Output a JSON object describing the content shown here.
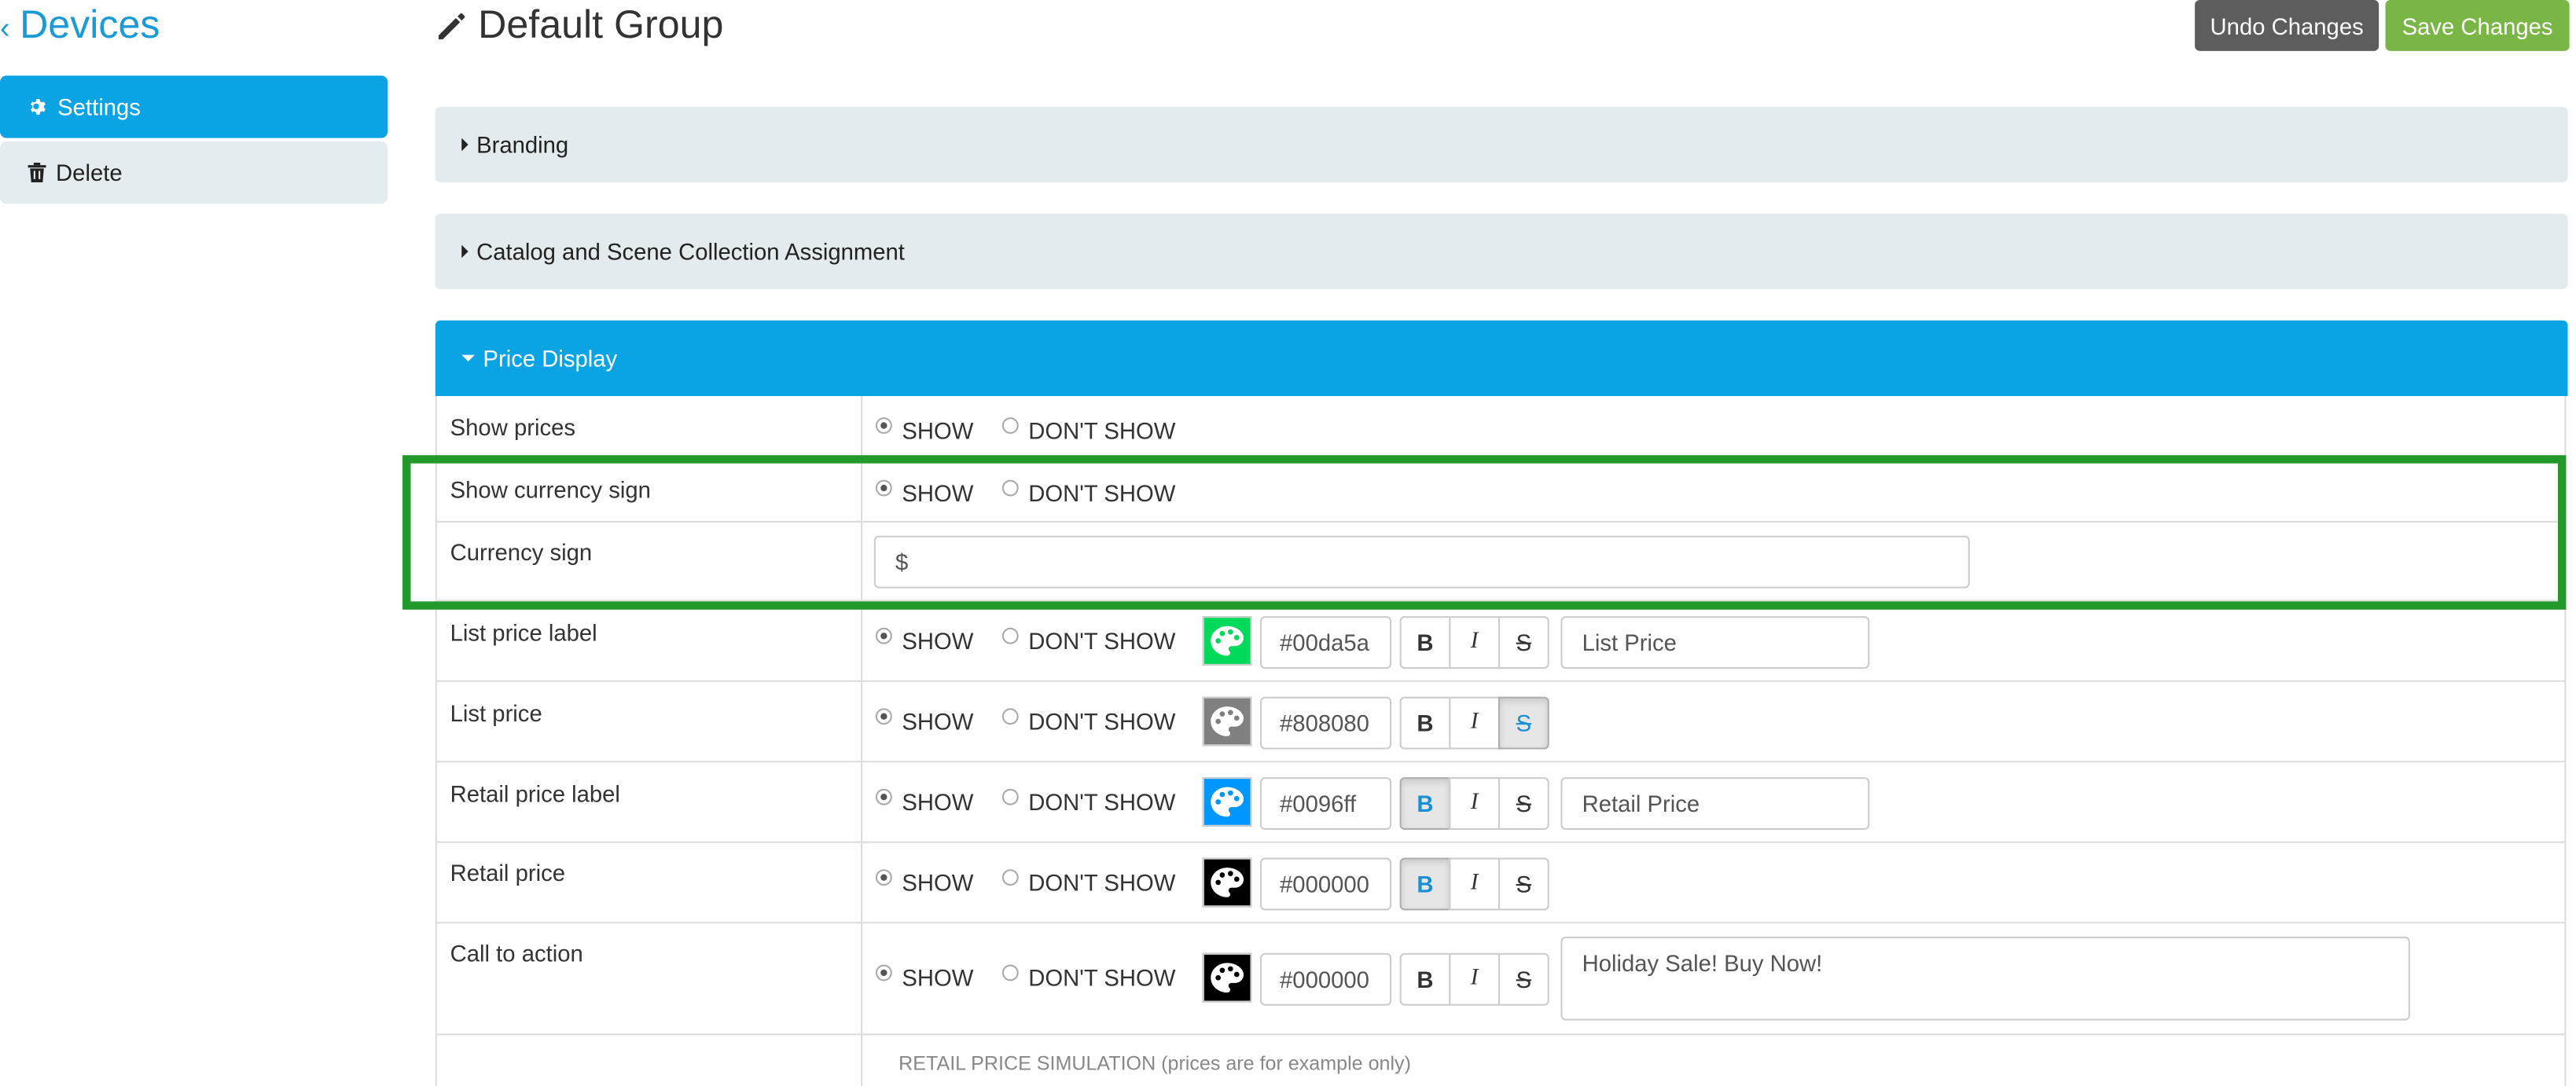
{
  "nav": {
    "back_label": "Devices",
    "items": [
      {
        "label": "Settings",
        "icon": "gear-icon",
        "active": true
      },
      {
        "label": "Delete",
        "icon": "trash-icon",
        "active": false
      }
    ]
  },
  "header": {
    "title": "Default Group",
    "title_icon": "pencil-icon",
    "undo_label": "Undo Changes",
    "save_label": "Save Changes"
  },
  "sections": {
    "branding": "Branding",
    "catalog": "Catalog and Scene Collection Assignment",
    "price_display": "Price Display"
  },
  "radio": {
    "show": "SHOW",
    "dont_show": "DON'T SHOW"
  },
  "rows": {
    "show_prices": {
      "label": "Show prices",
      "selected": "SHOW"
    },
    "show_currency_sign": {
      "label": "Show currency sign",
      "selected": "SHOW"
    },
    "currency_sign": {
      "label": "Currency sign",
      "value": "$"
    },
    "list_price_label": {
      "label": "List price label",
      "selected": "SHOW",
      "color": "#00da5a",
      "bold": false,
      "italic": false,
      "strike": false,
      "text": "List Price"
    },
    "list_price": {
      "label": "List price",
      "selected": "SHOW",
      "color": "#808080",
      "bold": false,
      "italic": false,
      "strike": true
    },
    "retail_price_label": {
      "label": "Retail price label",
      "selected": "SHOW",
      "color": "#0096ff",
      "bold": true,
      "italic": false,
      "strike": false,
      "text": "Retail Price"
    },
    "retail_price": {
      "label": "Retail price",
      "selected": "SHOW",
      "color": "#000000",
      "bold": true,
      "italic": false,
      "strike": false
    },
    "call_to_action": {
      "label": "Call to action",
      "selected": "SHOW",
      "color": "#000000",
      "bold": false,
      "italic": false,
      "strike": false,
      "text": "Holiday Sale! Buy Now!"
    }
  },
  "format": {
    "bold": "B",
    "italic": "I",
    "strike": "S"
  },
  "simulation_label": "RETAIL PRICE SIMULATION (prices are for example only)",
  "colors": {
    "accent": "#0aa3e4",
    "save": "#7ab645",
    "undo": "#5d5d5d",
    "highlight": "#23992b",
    "swatch_list_price_label": "#00da5a",
    "swatch_list_price": "#808080",
    "swatch_retail_price_label": "#0096ff",
    "swatch_retail_price": "#000000",
    "swatch_call_to_action": "#000000"
  }
}
